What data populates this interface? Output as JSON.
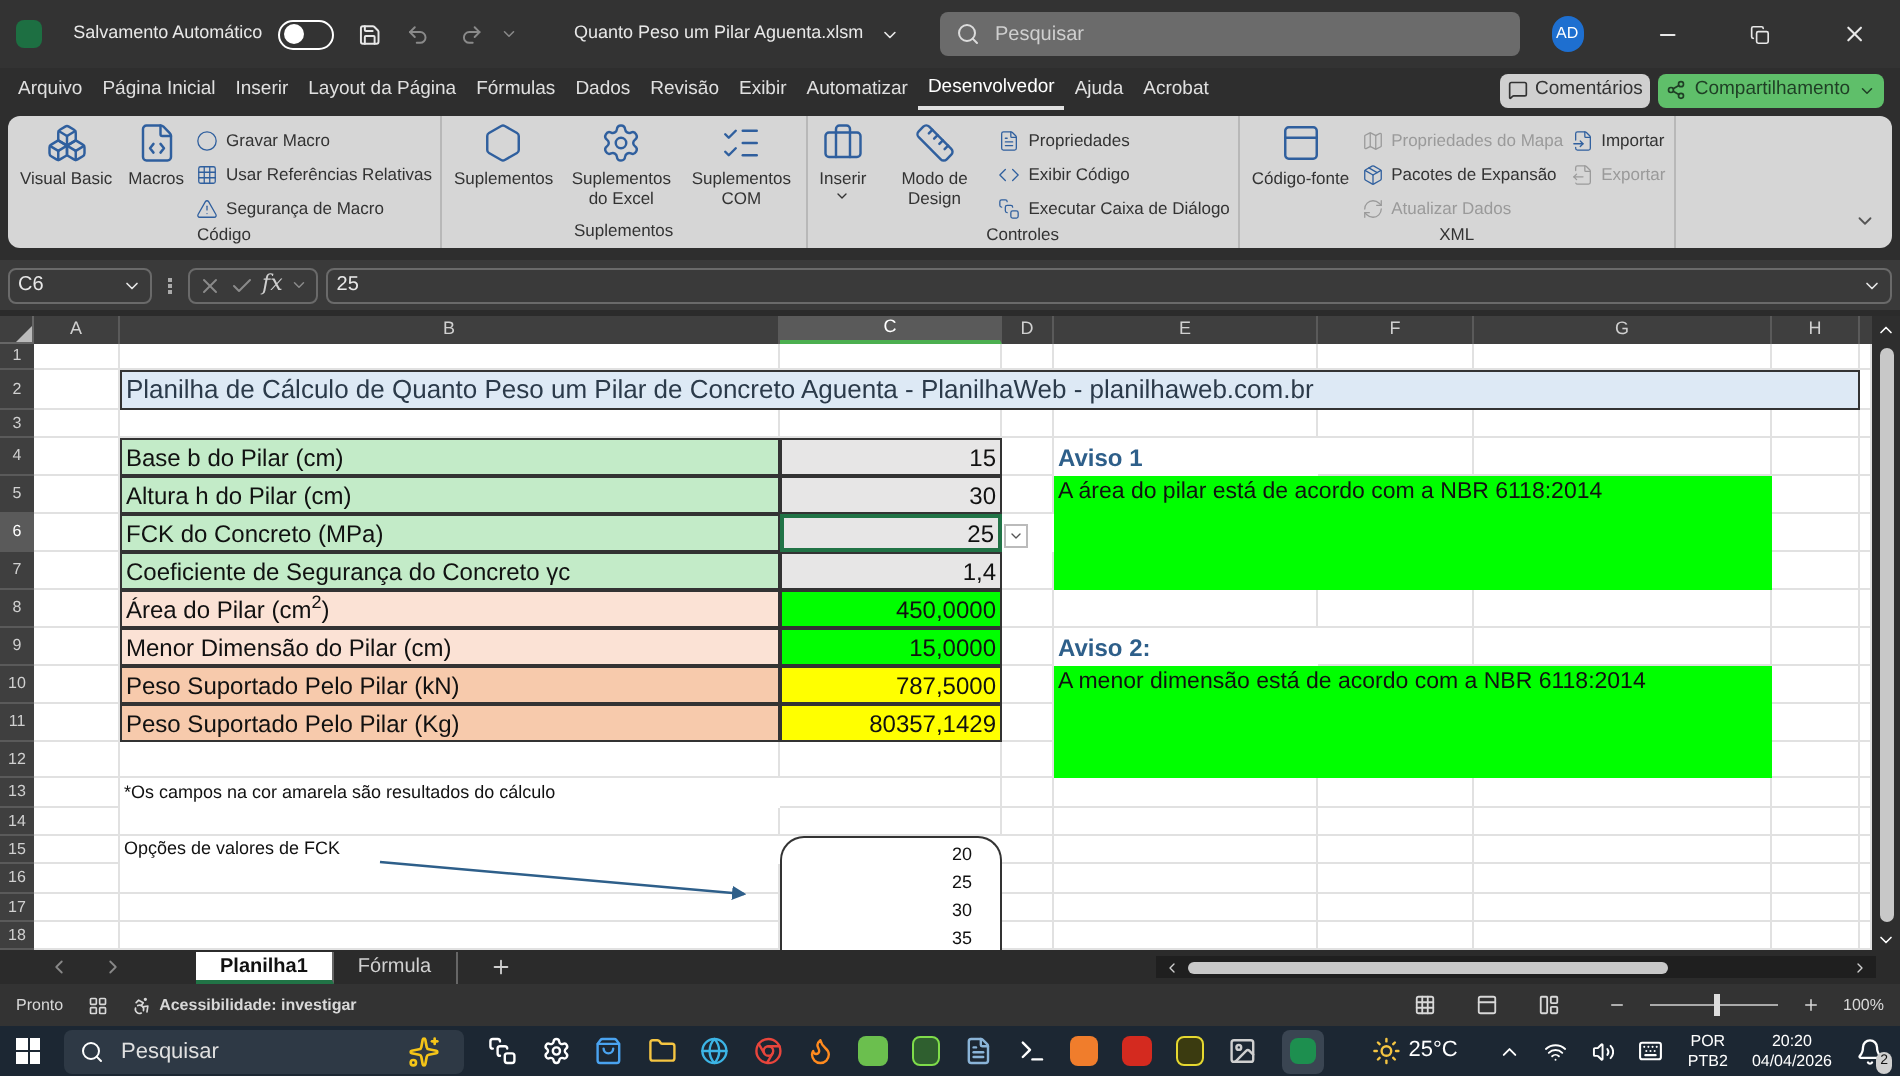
{
  "window": {
    "autosave_label": "Salvamento Automático",
    "autosave_on": false,
    "file_name": "Quanto Peso um Pilar Aguenta.xlsm",
    "search_placeholder": "Pesquisar",
    "user_initials": "AD"
  },
  "menu_tabs": [
    {
      "label": "Arquivo",
      "selected": false
    },
    {
      "label": "Página Inicial",
      "selected": false
    },
    {
      "label": "Inserir",
      "selected": false
    },
    {
      "label": "Layout da Página",
      "selected": false
    },
    {
      "label": "Fórmulas",
      "selected": false
    },
    {
      "label": "Dados",
      "selected": false
    },
    {
      "label": "Revisão",
      "selected": false
    },
    {
      "label": "Exibir",
      "selected": false
    },
    {
      "label": "Automatizar",
      "selected": false
    },
    {
      "label": "Desenvolvedor",
      "selected": true
    },
    {
      "label": "Ajuda",
      "selected": false
    },
    {
      "label": "Acrobat",
      "selected": false
    }
  ],
  "comments_button": "Comentários",
  "share_button": "Compartilhamento",
  "ribbon_groups": [
    {
      "label": "Código",
      "columns": [
        {
          "kind": "large",
          "label": "Visual Basic"
        },
        {
          "kind": "large",
          "label": "Macros"
        },
        {
          "kind": "stack",
          "items": [
            {
              "label": "Gravar Macro",
              "disabled": false
            },
            {
              "label": "Usar Referências Relativas",
              "disabled": false
            },
            {
              "label": "Segurança de Macro",
              "disabled": false
            }
          ]
        }
      ]
    },
    {
      "label": "Suplementos",
      "columns": [
        {
          "kind": "large",
          "label": "Suplementos"
        },
        {
          "kind": "large",
          "label": "Suplementos do Excel"
        },
        {
          "kind": "large",
          "label": "Suplementos COM"
        }
      ]
    },
    {
      "label": "Controles",
      "columns": [
        {
          "kind": "large",
          "label": "Inserir",
          "caret": true
        },
        {
          "kind": "large",
          "label": "Modo de Design"
        },
        {
          "kind": "stack",
          "items": [
            {
              "label": "Propriedades",
              "disabled": false
            },
            {
              "label": "Exibir Código",
              "disabled": false
            },
            {
              "label": "Executar Caixa de Diálogo",
              "disabled": false
            }
          ]
        }
      ]
    },
    {
      "label": "XML",
      "columns": [
        {
          "kind": "large",
          "label": "Código-fonte"
        },
        {
          "kind": "stack",
          "items": [
            {
              "label": "Propriedades do Mapa",
              "disabled": true
            },
            {
              "label": "Pacotes de Expansão",
              "disabled": false
            },
            {
              "label": "Atualizar Dados",
              "disabled": true
            }
          ]
        },
        {
          "kind": "stack",
          "items": [
            {
              "label": "Importar",
              "disabled": false
            },
            {
              "label": "Exportar",
              "disabled": true
            }
          ]
        }
      ]
    }
  ],
  "formula_bar": {
    "name_box": "C6",
    "function_label": "fx",
    "value": "25"
  },
  "columns": [
    {
      "label": "A",
      "selected": false
    },
    {
      "label": "B",
      "selected": false
    },
    {
      "label": "C",
      "selected": true
    },
    {
      "label": "D",
      "selected": false
    },
    {
      "label": "E",
      "selected": false
    },
    {
      "label": "F",
      "selected": false
    },
    {
      "label": "G",
      "selected": false
    },
    {
      "label": "H",
      "selected": false
    }
  ],
  "rows": [
    {
      "label": "1",
      "selected": false
    },
    {
      "label": "2",
      "selected": false
    },
    {
      "label": "3",
      "selected": false
    },
    {
      "label": "4",
      "selected": false
    },
    {
      "label": "5",
      "selected": false
    },
    {
      "label": "6",
      "selected": true
    },
    {
      "label": "7",
      "selected": false
    },
    {
      "label": "8",
      "selected": false
    },
    {
      "label": "9",
      "selected": false
    },
    {
      "label": "10",
      "selected": false
    },
    {
      "label": "11",
      "selected": false
    },
    {
      "label": "12",
      "selected": false
    },
    {
      "label": "13",
      "selected": false
    },
    {
      "label": "14",
      "selected": false
    },
    {
      "label": "15",
      "selected": false
    },
    {
      "label": "16",
      "selected": false
    },
    {
      "label": "17",
      "selected": false
    },
    {
      "label": "18",
      "selected": false
    }
  ],
  "sheet_title": "Planilha de Cálculo de Quanto Peso um Pilar de Concreto Aguenta - PlanilhaWeb - planilhaweb.com.br",
  "parameters": [
    {
      "label": "Base b do Pilar (cm)",
      "value": "15",
      "kind": "input",
      "selected": false
    },
    {
      "label": "Altura h do Pilar (cm)",
      "value": "30",
      "kind": "input",
      "selected": false
    },
    {
      "label": "FCK do Concreto (MPa)",
      "value": "25",
      "kind": "input",
      "selected": true
    },
    {
      "label": "Coeficiente de Segurança do Concreto γc",
      "value": "1,4",
      "kind": "input",
      "selected": false
    },
    {
      "label": "Área do Pilar (cm$^{2}$)",
      "value": "450,0000",
      "kind": "check",
      "selected": false
    },
    {
      "label": "Menor Dimensão do Pilar (cm)",
      "value": "15,0000",
      "kind": "check",
      "selected": false
    },
    {
      "label": "Peso Suportado Pelo Pilar (kN)",
      "value": "787,5000",
      "kind": "result",
      "selected": false
    },
    {
      "label": "Peso Suportado Pelo Pilar (Kg)",
      "value": "80357,1429",
      "kind": "result",
      "selected": false
    }
  ],
  "note": "*Os campos na cor amarela são resultados do cálculo",
  "fck_options": {
    "label": "Opções de valores de FCK",
    "values": [
      "20",
      "25",
      "30",
      "35"
    ]
  },
  "warnings": [
    {
      "title": "Aviso 1",
      "message": "A área do pilar está de acordo com a NBR 6118:2014"
    },
    {
      "title": "Aviso 2:",
      "message": "A menor dimensão está de acordo com a NBR 6118:2014"
    }
  ],
  "sheet_tabs": [
    {
      "label": "Planilha1",
      "selected": true
    },
    {
      "label": "Fórmula",
      "selected": false
    }
  ],
  "status_bar": {
    "ready": "Pronto",
    "accessibility": "Acessibilidade: investigar",
    "zoom": "100%",
    "level": 0.5
  },
  "taskbar": {
    "search_placeholder": "Pesquisar",
    "temperature": "25°C",
    "language": "POR",
    "layout": "PTB2",
    "time": "20:20",
    "date": "04/04/2026",
    "notifications": "2"
  }
}
